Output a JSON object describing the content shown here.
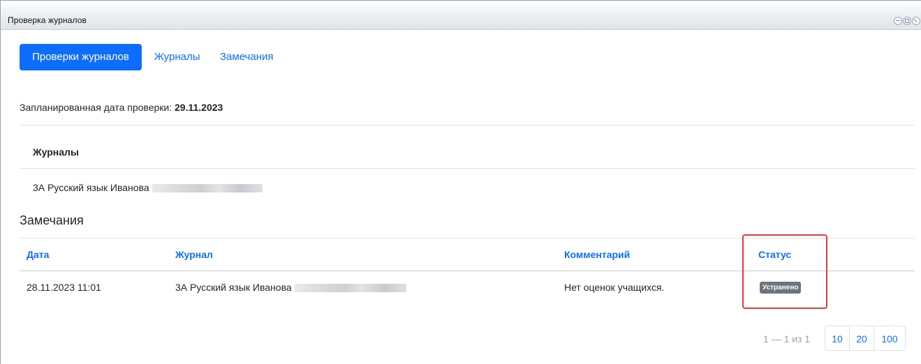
{
  "window": {
    "title": "Проверка журналов"
  },
  "tabs": [
    {
      "label": "Проверки журналов",
      "active": true
    },
    {
      "label": "Журналы",
      "active": false
    },
    {
      "label": "Замечания",
      "active": false
    }
  ],
  "planned": {
    "label": "Запланированная дата проверки: ",
    "date": "29.11.2023"
  },
  "journals": {
    "heading": "Журналы",
    "items": [
      {
        "name": "3А Русский язык Иванова"
      }
    ]
  },
  "remarks": {
    "title": "Замечания",
    "columns": [
      "Дата",
      "Журнал",
      "Комментарий",
      "Статус"
    ],
    "rows": [
      {
        "date": "28.11.2023 11:01",
        "journal": "3А Русский язык Иванова",
        "comment": "Нет оценок учащихся.",
        "status": "Устранено"
      }
    ]
  },
  "pagination": {
    "info": "1 — 1 из 1",
    "page_sizes": [
      "10",
      "20",
      "100"
    ]
  },
  "colors": {
    "accent": "#0d6efd",
    "badge": "#6c757d",
    "highlight": "#e0393e"
  }
}
